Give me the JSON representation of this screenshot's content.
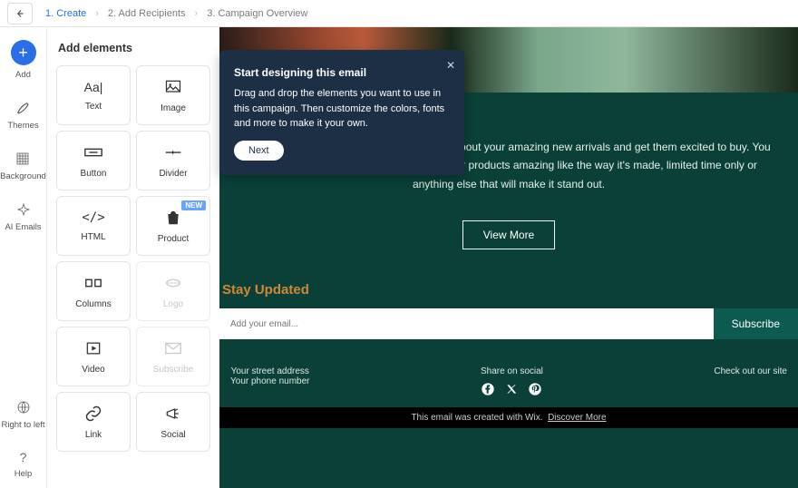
{
  "breadcrumb": {
    "s1": "1. Create",
    "s2": "2. Add Recipients",
    "s3": "3. Campaign Overview"
  },
  "rail": {
    "add": "Add",
    "themes": "Themes",
    "background": "Background",
    "ai": "AI Emails",
    "rtl": "Right to left",
    "help": "Help"
  },
  "panel": {
    "title": "Add elements"
  },
  "elements": {
    "text": "Text",
    "image": "Image",
    "button": "Button",
    "divider": "Divider",
    "html": "HTML",
    "product": "Product",
    "columns": "Columns",
    "logo": "Logo",
    "video": "Video",
    "subscribe": "Subscribe",
    "link": "Link",
    "social": "Social",
    "new": "NEW"
  },
  "tip": {
    "title": "Start designing this email",
    "body": "Drag and drop the elements you want to use in this campaign. Then customize the colors, fonts and more to make it your own.",
    "next": "Next"
  },
  "canvas": {
    "desc": "This is a great place to tell your customers about your amazing new arrivals and get them excited to buy. You can tell them more about what makes your products amazing like the way it's made, limited time only or anything else that will make it stand out.",
    "view": "View More",
    "stay": "Stay Updated",
    "placeholder": "Add your email...",
    "subscribe": "Subscribe",
    "addr1": "Your street address",
    "addr2": "Your phone number",
    "share": "Share on social",
    "check": "Check out our site",
    "credit": "This email was created with Wix.",
    "discover": "Discover More"
  }
}
